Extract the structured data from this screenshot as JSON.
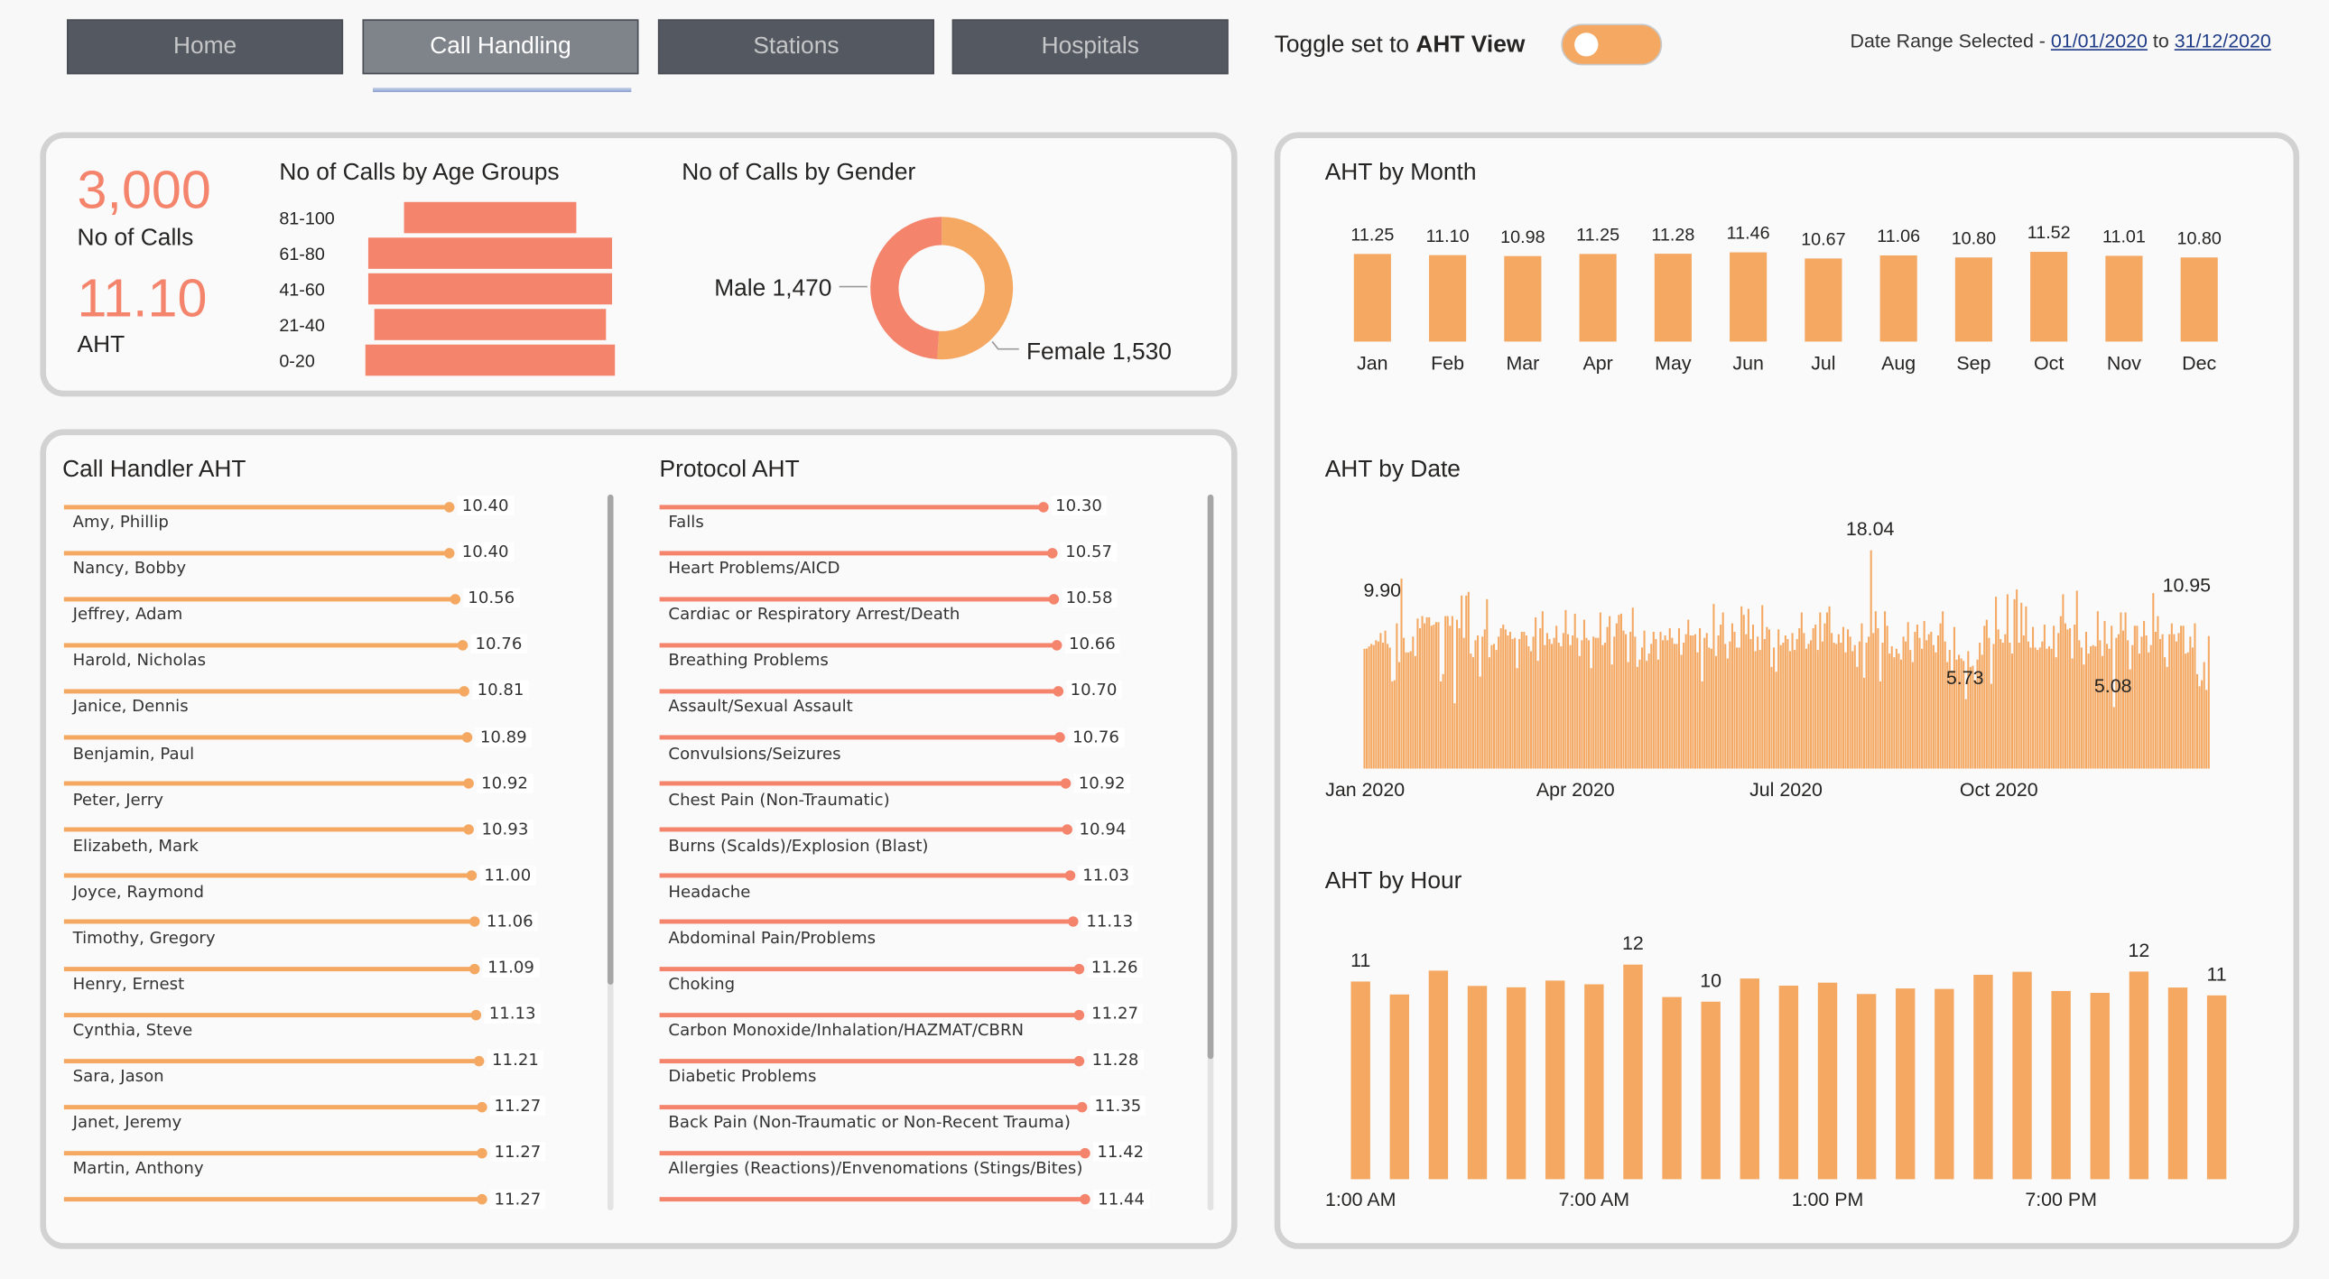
{
  "nav": {
    "tabs": [
      {
        "label": "Home",
        "active": false
      },
      {
        "label": "Call Handling",
        "active": true
      },
      {
        "label": "Stations",
        "active": false
      },
      {
        "label": "Hospitals",
        "active": false
      }
    ]
  },
  "toggle": {
    "prefix": "Toggle set to",
    "bold": "AHT View"
  },
  "date_range": {
    "label": "Date Range Selected -",
    "start": "01/01/2020",
    "sep": "to",
    "end": "31/12/2020"
  },
  "kpis": {
    "calls": {
      "value": "3,000",
      "label": "No of Calls"
    },
    "aht": {
      "value": "11.10",
      "label": "AHT"
    }
  },
  "colors": {
    "orange": "#f4a862",
    "salmon": "#f4846c",
    "tab": "#545860",
    "tab_active": "#7f838a"
  },
  "chart_data": [
    {
      "id": "age",
      "type": "bar",
      "orientation": "horizontal-funnel",
      "title": "No of Calls by Age Groups",
      "categories": [
        "81-100",
        "61-80",
        "41-60",
        "21-40",
        "0-20"
      ],
      "values": [
        453,
        641,
        641,
        609,
        656
      ],
      "color": "#f4846c"
    },
    {
      "id": "gender",
      "type": "pie",
      "style": "donut",
      "title": "No of Calls by Gender",
      "slices": [
        {
          "label": "Female",
          "value": 1530,
          "text": "Female 1,530",
          "color": "#f4a862"
        },
        {
          "label": "Male",
          "value": 1470,
          "text": "Male 1,470",
          "color": "#f4846c"
        }
      ]
    },
    {
      "id": "handler",
      "type": "bar",
      "style": "lollipop",
      "title": "Call Handler AHT",
      "color": "#f4a862",
      "categories": [
        "Amy, Phillip",
        "Nancy, Bobby",
        "Jeffrey, Adam",
        "Harold, Nicholas",
        "Janice, Dennis",
        "Benjamin, Paul",
        "Peter, Jerry",
        "Elizabeth, Mark",
        "Joyce, Raymond",
        "Timothy, Gregory",
        "Henry, Ernest",
        "Cynthia, Steve",
        "Sara, Jason",
        "Janet, Jeremy",
        "Martin, Anthony",
        ""
      ],
      "values": [
        10.4,
        10.4,
        10.56,
        10.76,
        10.81,
        10.89,
        10.92,
        10.93,
        11.0,
        11.06,
        11.09,
        11.13,
        11.21,
        11.27,
        11.27,
        11.27
      ]
    },
    {
      "id": "protocol",
      "type": "bar",
      "style": "lollipop",
      "title": "Protocol AHT",
      "color": "#f4846c",
      "categories": [
        "Falls",
        "Heart Problems/AICD",
        "Cardiac or Respiratory Arrest/Death",
        "Breathing Problems",
        "Assault/Sexual Assault",
        "Convulsions/Seizures",
        "Chest Pain (Non-Traumatic)",
        "Burns (Scalds)/Explosion (Blast)",
        "Headache",
        "Abdominal Pain/Problems",
        "Choking",
        "Carbon Monoxide/Inhalation/HAZMAT/CBRN",
        "Diabetic Problems",
        "Back Pain (Non-Traumatic or Non-Recent Trauma)",
        "Allergies (Reactions)/Envenomations (Stings/Bites)",
        ""
      ],
      "values": [
        10.3,
        10.57,
        10.58,
        10.66,
        10.7,
        10.76,
        10.92,
        10.94,
        11.03,
        11.13,
        11.26,
        11.27,
        11.28,
        11.35,
        11.42,
        11.44
      ]
    },
    {
      "id": "month",
      "type": "bar",
      "title": "AHT by Month",
      "color": "#f4a862",
      "categories": [
        "Jan",
        "Feb",
        "Mar",
        "Apr",
        "May",
        "Jun",
        "Jul",
        "Aug",
        "Sep",
        "Oct",
        "Nov",
        "Dec"
      ],
      "values": [
        11.25,
        11.1,
        10.98,
        11.25,
        11.28,
        11.46,
        10.67,
        11.06,
        10.8,
        11.52,
        11.01,
        10.8
      ],
      "ylim": [
        0,
        11.52
      ]
    },
    {
      "id": "date",
      "type": "bar",
      "title": "AHT by Date",
      "color": "#f4a862",
      "x_start": "2020-01-01",
      "x_ticks": [
        {
          "date": "2020-01-01",
          "label": "Jan 2020"
        },
        {
          "date": "2020-04-01",
          "label": "Apr 2020"
        },
        {
          "date": "2020-07-01",
          "label": "Jul 2020"
        },
        {
          "date": "2020-10-01",
          "label": "Oct 2020"
        }
      ],
      "data_labels": [
        {
          "date": "2020-01-01",
          "text": "9.90"
        },
        {
          "date": "2020-08-07",
          "text": "18.04"
        },
        {
          "date": "2020-09-17",
          "text": "5.73"
        },
        {
          "date": "2020-11-20",
          "text": "5.08"
        },
        {
          "date": "2020-12-31",
          "text": "10.95"
        }
      ],
      "ylim": [
        0,
        18.04
      ],
      "values": [
        9.9,
        9.92,
        10.1,
        10.3,
        10.2,
        10.6,
        10.5,
        11.2,
        10.4,
        11.4,
        10.3,
        10.0,
        7.2,
        7.3,
        12.0,
        8.8,
        15.7,
        10.8,
        9.6,
        9.6,
        9.7,
        10.9,
        9.3,
        12.4,
        11.6,
        12.6,
        12.0,
        12.5,
        12.5,
        11.8,
        11.9,
        12.1,
        12.1,
        7.2,
        7.8,
        12.6,
        12.6,
        11.8,
        12.6,
        5.4,
        12.3,
        11.6,
        14.3,
        10.8,
        14.3,
        14.6,
        9.5,
        9.2,
        10.6,
        11.0,
        7.6,
        10.9,
        11.5,
        14.0,
        9.2,
        10.2,
        10.3,
        9.8,
        10.9,
        11.6,
        11.9,
        11.5,
        11.0,
        11.3,
        10.7,
        10.8,
        8.3,
        10.7,
        11.3,
        11.3,
        11.0,
        10.1,
        9.7,
        10.9,
        12.5,
        8.9,
        11.6,
        13.0,
        10.2,
        11.2,
        10.7,
        10.3,
        10.8,
        11.8,
        10.4,
        10.1,
        11.2,
        13.1,
        11.1,
        10.2,
        11.0,
        12.8,
        10.8,
        9.3,
        10.6,
        12.3,
        10.8,
        10.6,
        8.3,
        10.9,
        10.8,
        10.8,
        12.9,
        10.2,
        10.4,
        11.7,
        12.6,
        8.6,
        10.9,
        12.0,
        12.7,
        12.8,
        11.4,
        11.1,
        8.8,
        11.3,
        13.3,
        10.9,
        8.4,
        9.0,
        10.0,
        11.4,
        8.9,
        9.5,
        10.3,
        11.3,
        10.7,
        9.0,
        11.3,
        10.6,
        11.0,
        10.6,
        11.6,
        10.8,
        10.3,
        10.3,
        11.6,
        9.4,
        10.4,
        11.1,
        12.3,
        11.0,
        11.0,
        11.1,
        9.6,
        11.6,
        7.2,
        10.8,
        11.2,
        10.0,
        9.9,
        13.6,
        9.3,
        11.0,
        11.9,
        12.9,
        10.3,
        9.1,
        10.5,
        12.0,
        11.3,
        10.0,
        10.0,
        13.4,
        12.7,
        11.1,
        13.2,
        10.7,
        11.9,
        9.7,
        10.9,
        9.8,
        13.5,
        10.7,
        11.7,
        11.5,
        8.4,
        10.0,
        8.0,
        11.5,
        10.2,
        10.4,
        11.0,
        10.7,
        9.7,
        11.2,
        9.8,
        10.7,
        11.6,
        12.9,
        11.2,
        9.9,
        10.3,
        10.6,
        11.6,
        11.9,
        9.8,
        12.9,
        10.5,
        12.0,
        12.9,
        13.4,
        11.2,
        10.4,
        10.3,
        11.1,
        10.4,
        11.7,
        9.6,
        11.5,
        10.9,
        9.7,
        10.2,
        8.4,
        10.5,
        12.0,
        7.5,
        10.4,
        10.9,
        18.04,
        11.2,
        13.0,
        11.6,
        7.2,
        10.4,
        13.0,
        11.8,
        9.5,
        10.1,
        9.2,
        9.9,
        9.5,
        9.0,
        10.9,
        10.5,
        12.1,
        9.8,
        8.8,
        11.3,
        11.9,
        10.8,
        9.9,
        12.2,
        10.6,
        11.1,
        11.3,
        10.2,
        9.6,
        11.0,
        12.0,
        13.0,
        10.5,
        8.8,
        9.8,
        8.1,
        11.7,
        9.0,
        9.4,
        9.1,
        8.9,
        5.73,
        9.7,
        8.4,
        8.5,
        7.3,
        9.0,
        10.4,
        9.4,
        11.8,
        12.3,
        10.8,
        7.0,
        10.3,
        14.2,
        11.5,
        10.7,
        10.4,
        11.1,
        14.4,
        10.4,
        9.5,
        14.0,
        14.8,
        10.4,
        13.7,
        11.0,
        13.4,
        10.5,
        10.0,
        11.7,
        10.0,
        9.8,
        10.0,
        10.5,
        11.9,
        9.9,
        10.1,
        9.9,
        11.8,
        9.2,
        11.2,
        12.6,
        14.4,
        12.0,
        11.5,
        11.6,
        9.1,
        11.9,
        14.7,
        10.6,
        10.0,
        8.6,
        11.3,
        9.5,
        10.1,
        10.2,
        10.1,
        13.0,
        10.6,
        9.3,
        12.2,
        10.3,
        9.9,
        11.8,
        5.08,
        10.8,
        11.1,
        12.9,
        11.4,
        12.9,
        10.6,
        8.2,
        10.2,
        11.8,
        11.8,
        9.5,
        10.9,
        12.2,
        11.0,
        9.6,
        10.2,
        14.5,
        11.3,
        12.6,
        10.7,
        11.1,
        9.2,
        8.4,
        11.1,
        12.0,
        11.1,
        10.5,
        11.2,
        11.8,
        11.8,
        9.5,
        9.6,
        10.9,
        10.0,
        12.0,
        7.8,
        6.8,
        7.3,
        8.8,
        6.5,
        10.95
      ]
    },
    {
      "id": "hour",
      "type": "bar",
      "title": "AHT by Hour",
      "color": "#f4a862",
      "categories": [
        "1:00 AM",
        "2:00 AM",
        "3:00 AM",
        "4:00 AM",
        "5:00 AM",
        "6:00 AM",
        "7:00 AM",
        "8:00 AM",
        "9:00 AM",
        "10:00 AM",
        "11:00 AM",
        "12:00 PM",
        "1:00 PM",
        "2:00 PM",
        "3:00 PM",
        "4:00 PM",
        "5:00 PM",
        "6:00 PM",
        "7:00 PM",
        "8:00 PM",
        "9:00 PM",
        "10:00 PM",
        "11:00 PM"
      ],
      "x_ticks": [
        "1:00 AM",
        "7:00 AM",
        "1:00 PM",
        "7:00 PM"
      ],
      "values": [
        11.27,
        10.71,
        11.74,
        11.08,
        11.02,
        11.31,
        11.15,
        12.0,
        10.6,
        10.4,
        11.4,
        11.09,
        11.22,
        10.73,
        10.97,
        10.95,
        11.56,
        11.69,
        10.86,
        10.78,
        11.7,
        11.01,
        10.67
      ],
      "data_labels": [
        {
          "category": "1:00 AM",
          "text": "11"
        },
        {
          "category": "8:00 AM",
          "text": "12"
        },
        {
          "category": "10:00 AM",
          "text": "10"
        },
        {
          "category": "9:00 PM",
          "text": "12"
        },
        {
          "category": "11:00 PM",
          "text": "11"
        }
      ],
      "ylim": [
        2.73,
        12.0
      ]
    }
  ]
}
